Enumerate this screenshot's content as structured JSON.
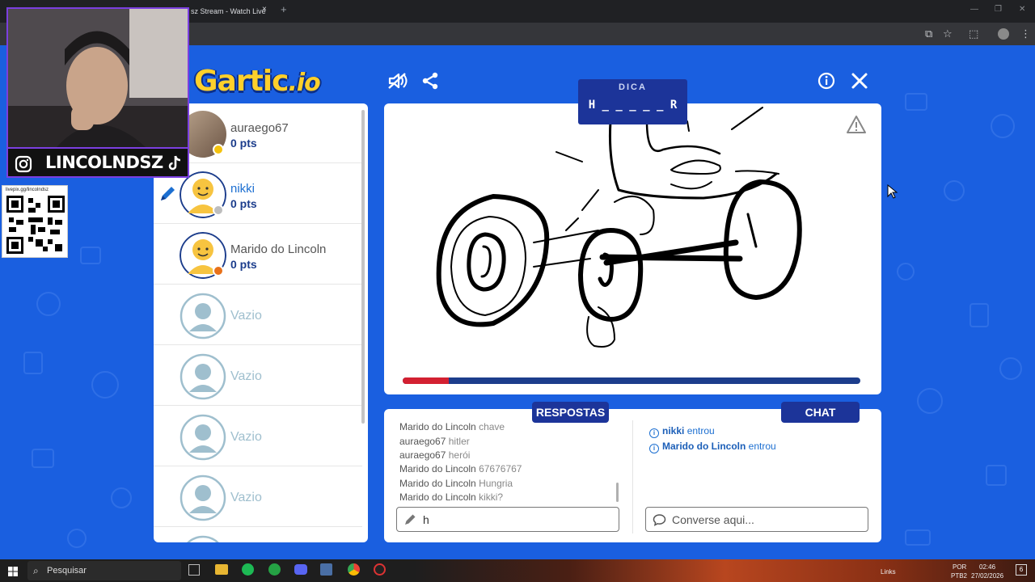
{
  "browser": {
    "tab_title": "sz Stream - Watch Live",
    "tab_close": "×",
    "new_tab": "+"
  },
  "game": {
    "logo_text": "Gartic",
    "logo_suffix": ".io",
    "hint": {
      "label": "DICA",
      "word": "H _ _ _ _ _ R"
    },
    "round_progress": 0.1,
    "progress_color": "#d32031"
  },
  "players": [
    {
      "name": "auraego67",
      "points": "0 pts",
      "status_color": "#f4c20d",
      "avatar": "photo-avatar"
    },
    {
      "name": "nikki",
      "points": "0 pts",
      "status_color": "#bdbdbd",
      "avatar": "cartoon-avatar",
      "drawing": true
    },
    {
      "name": "Marido do Lincoln",
      "points": "0 pts",
      "status_color": "#e8711a",
      "avatar": "cartoon-avatar"
    },
    {
      "name": "Vazio"
    },
    {
      "name": "Vazio"
    },
    {
      "name": "Vazio"
    },
    {
      "name": "Vazio"
    }
  ],
  "answers": {
    "tab_label": "RESPOSTAS",
    "lines": [
      {
        "who": "Marido do Lincoln",
        "what": "chave"
      },
      {
        "who": "auraego67",
        "what": "hitler"
      },
      {
        "who": "auraego67",
        "what": "herói"
      },
      {
        "who": "Marido do Lincoln",
        "what": "67676767"
      },
      {
        "who": "Marido do Lincoln",
        "what": "Hungria"
      },
      {
        "who": "Marido do Lincoln",
        "what": "kikki?"
      }
    ],
    "input_value": "h"
  },
  "chat": {
    "tab_label": "CHAT",
    "lines": [
      {
        "who": "nikki",
        "what": "entrou"
      },
      {
        "who": "Marido do Lincoln",
        "what": "entrou"
      }
    ],
    "input_placeholder": "Converse aqui..."
  },
  "stream_overlay": {
    "handle": "LINCOLNDSZ",
    "qr_url": "livepix.gg/lincolndsz"
  },
  "taskbar": {
    "search_label": "Pesquisar",
    "links_label": "Links",
    "lang": "POR",
    "lang2": "PTB2",
    "time": "02:46",
    "date": "27/02/2026",
    "notif_count": "6"
  }
}
